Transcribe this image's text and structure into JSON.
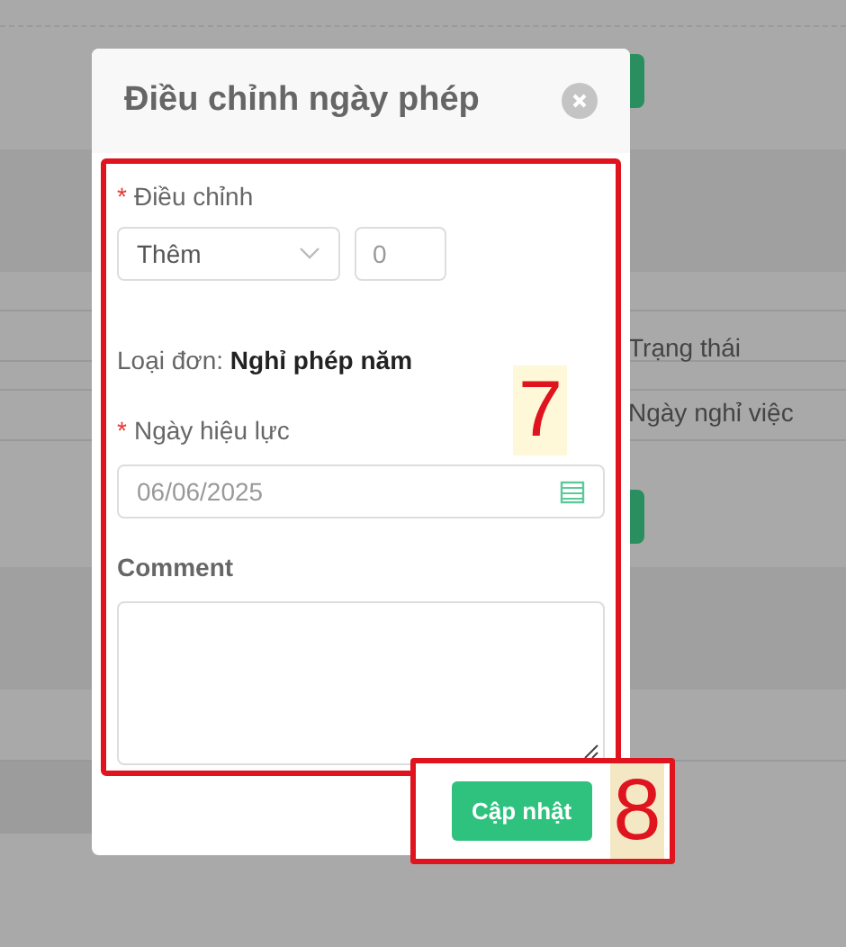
{
  "background": {
    "labels": [
      "Trạng thái",
      "Ngày nghỉ việc"
    ]
  },
  "dialog": {
    "title": "Điều chỉnh ngày phép",
    "adjust": {
      "required_mark": "*",
      "label": "Điều chỉnh",
      "select_value": "Thêm",
      "amount": "0"
    },
    "leave_type": {
      "label": "Loại đơn:",
      "value": "Nghỉ phép năm"
    },
    "effective_date": {
      "required_mark": "*",
      "label": "Ngày hiệu lực",
      "value": "06/06/2025"
    },
    "comment": {
      "label": "Comment"
    },
    "submit": "Cập nhật"
  },
  "annotations": [
    {
      "label": "7"
    },
    {
      "label": "8"
    }
  ]
}
